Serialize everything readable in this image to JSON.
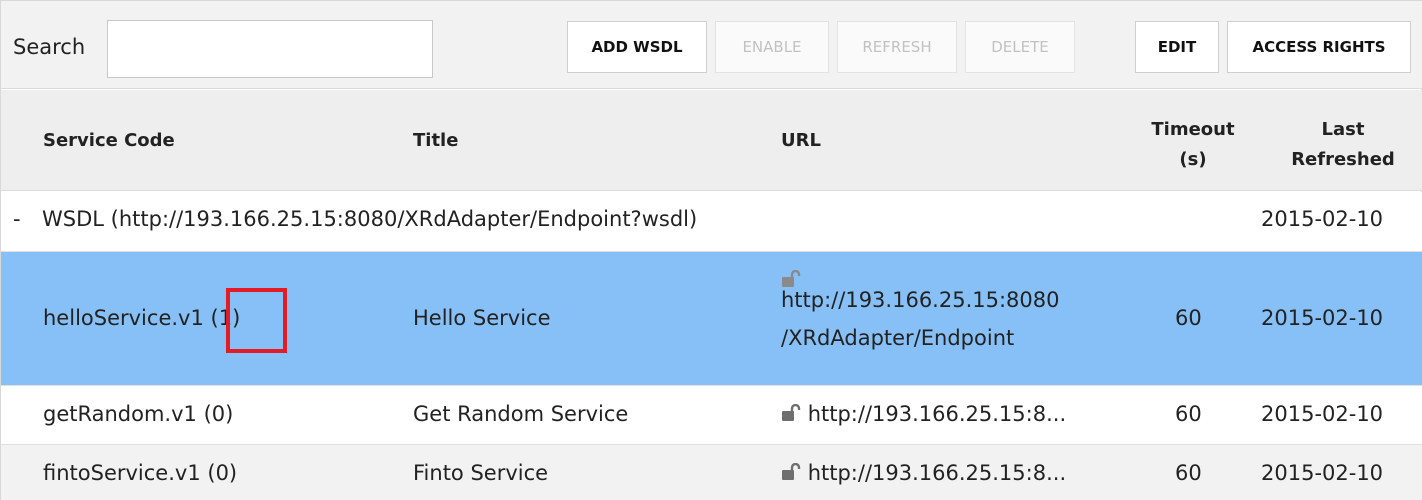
{
  "toolbar": {
    "search_label": "Search",
    "search_value": "",
    "search_placeholder": "",
    "buttons": {
      "add_wsdl": "ADD WSDL",
      "enable": "ENABLE",
      "refresh": "REFRESH",
      "delete": "DELETE",
      "edit": "EDIT",
      "access_rights": "ACCESS RIGHTS"
    }
  },
  "table": {
    "headers": {
      "service_code": "Service Code",
      "title": "Title",
      "url": "URL",
      "timeout_line1": "Timeout",
      "timeout_line2": "(s)",
      "last_refreshed_line1": "Last",
      "last_refreshed_line2": "Refreshed"
    },
    "group": {
      "toggle": "-",
      "label": "WSDL (http://193.166.25.15:8080/XRdAdapter/Endpoint?wsdl)",
      "last_refreshed": "2015-02-10"
    },
    "rows": [
      {
        "service_code": "helloService.v1",
        "access_count": "(1)",
        "title": "Hello Service",
        "url_line1": "http://193.166.25.15:8080",
        "url_line2": "/XRdAdapter/Endpoint",
        "timeout": "60",
        "last_refreshed": "2015-02-10",
        "icon": "unlocked-lock-icon"
      },
      {
        "service_code": "getRandom.v1 (0)",
        "title": "Get Random Service",
        "url": "http://193.166.25.15:8...",
        "timeout": "60",
        "last_refreshed": "2015-02-10",
        "icon": "unlocked-lock-icon"
      },
      {
        "service_code": "fintoService.v1 (0)",
        "title": "Finto Service",
        "url": "http://193.166.25.15:8...",
        "timeout": "60",
        "last_refreshed": "2015-02-10",
        "icon": "unlocked-lock-icon"
      }
    ]
  },
  "colors": {
    "selected_row": "#86c0f6",
    "highlight": "#e21b25",
    "header_bg": "#eeeeee"
  }
}
